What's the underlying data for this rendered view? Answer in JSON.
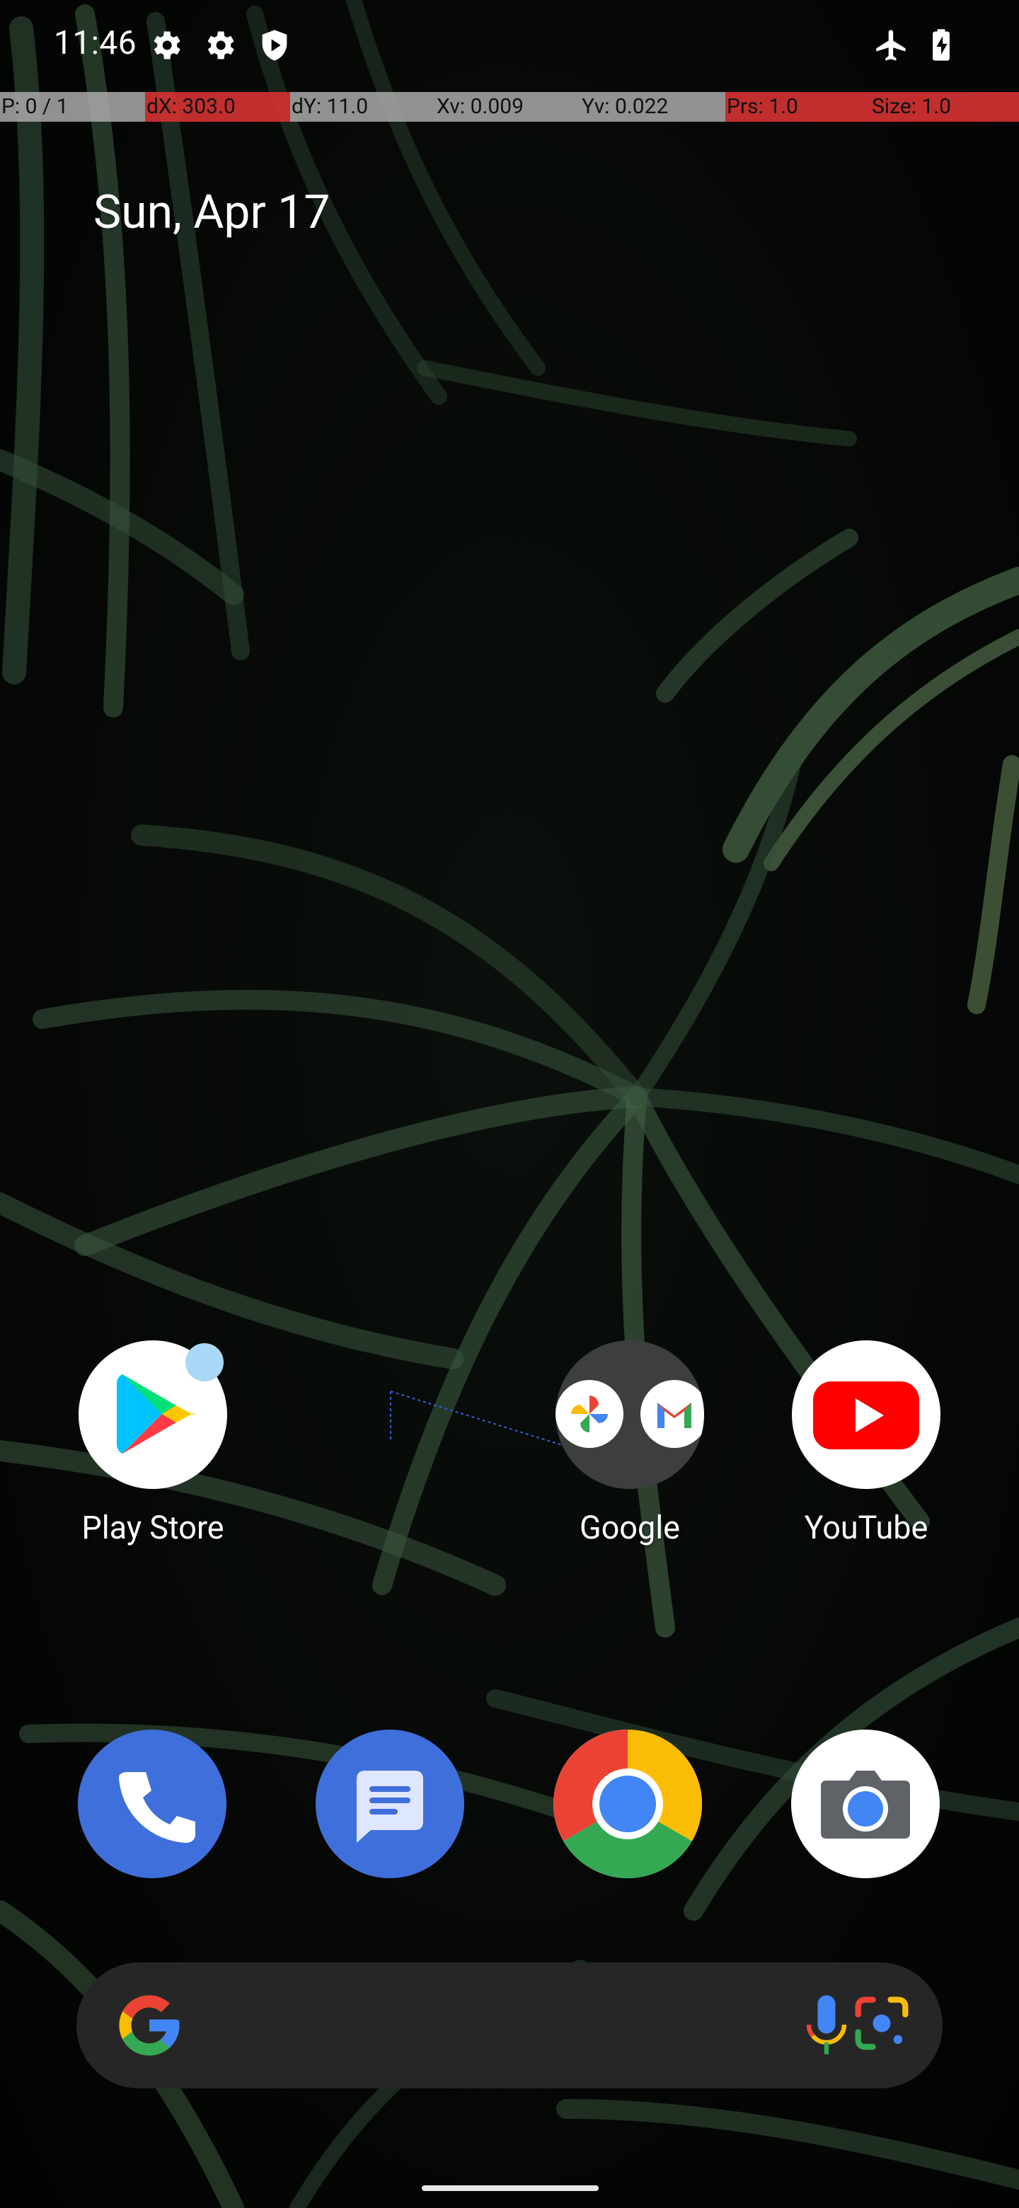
{
  "status_bar": {
    "time": "11:46",
    "icons": [
      "gear-icon",
      "gear-icon",
      "shield-icon",
      "airplane-mode-icon",
      "battery-charging-icon"
    ]
  },
  "pointer_overlay": {
    "cells": [
      "P: 0 / 1",
      "dX: 303.0",
      "dY: 11.0",
      "Xv: 0.009",
      "Yv: 0.022",
      "Prs: 1.0",
      "Size: 1.0"
    ]
  },
  "home": {
    "date": "Sun, Apr 17",
    "apps": [
      {
        "label": "Play Store",
        "icon": "play-store-icon",
        "notification_dot": true
      },
      {
        "label": "Google",
        "icon": "google-folder-icon"
      },
      {
        "label": "YouTube",
        "icon": "youtube-icon"
      }
    ],
    "dock": [
      "phone-icon",
      "messages-icon",
      "chrome-icon",
      "camera-icon"
    ]
  },
  "search_bar": {
    "icons": [
      "google-g-icon",
      "microphone-icon",
      "google-lens-icon"
    ]
  },
  "colors": {
    "google_blue": "#4285F4",
    "google_red": "#EA4335",
    "google_yellow": "#FBBC05",
    "google_green": "#34A853",
    "youtube_red": "#FF0000",
    "dock_blue": "#3F6FDB"
  }
}
